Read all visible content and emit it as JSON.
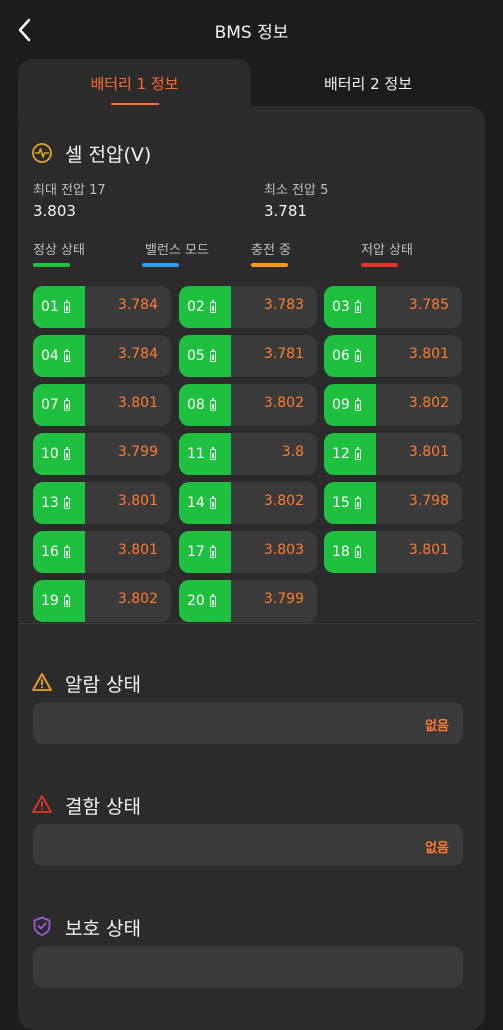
{
  "header": {
    "title": "BMS 정보"
  },
  "tabs": [
    {
      "label": "배터리 1 정보",
      "active": true
    },
    {
      "label": "배터리 2 정보",
      "active": false
    }
  ],
  "cell_voltage": {
    "title": "셀 전압(V)",
    "icon": "pulse-icon",
    "max_label": "최대 전압 17",
    "max_value": "3.803",
    "min_label": "최소 전압 5",
    "min_value": "3.781"
  },
  "legend": [
    {
      "label": "정상 상태",
      "color": "#22c13e"
    },
    {
      "label": "밸런스 모드",
      "color": "#2c9cf0"
    },
    {
      "label": "충전 중",
      "color": "#f59a1c"
    },
    {
      "label": "저압 상태",
      "color": "#e2332a"
    }
  ],
  "cells": [
    {
      "num": "01",
      "value": "3.784"
    },
    {
      "num": "02",
      "value": "3.783"
    },
    {
      "num": "03",
      "value": "3.785"
    },
    {
      "num": "04",
      "value": "3.784"
    },
    {
      "num": "05",
      "value": "3.781"
    },
    {
      "num": "06",
      "value": "3.801"
    },
    {
      "num": "07",
      "value": "3.801"
    },
    {
      "num": "08",
      "value": "3.802"
    },
    {
      "num": "09",
      "value": "3.802"
    },
    {
      "num": "10",
      "value": "3.799"
    },
    {
      "num": "11",
      "value": "3.8"
    },
    {
      "num": "12",
      "value": "3.801"
    },
    {
      "num": "13",
      "value": "3.801"
    },
    {
      "num": "14",
      "value": "3.802"
    },
    {
      "num": "15",
      "value": "3.798"
    },
    {
      "num": "16",
      "value": "3.801"
    },
    {
      "num": "17",
      "value": "3.803"
    },
    {
      "num": "18",
      "value": "3.801"
    },
    {
      "num": "19",
      "value": "3.802"
    },
    {
      "num": "20",
      "value": "3.799"
    }
  ],
  "alarm": {
    "title": "알람 상태",
    "value": "없음",
    "icon": "warning-icon"
  },
  "fault": {
    "title": "결함 상태",
    "value": "없음",
    "icon": "warning-icon"
  },
  "protection": {
    "title": "보호 상태",
    "value": "",
    "icon": "shield-icon"
  }
}
